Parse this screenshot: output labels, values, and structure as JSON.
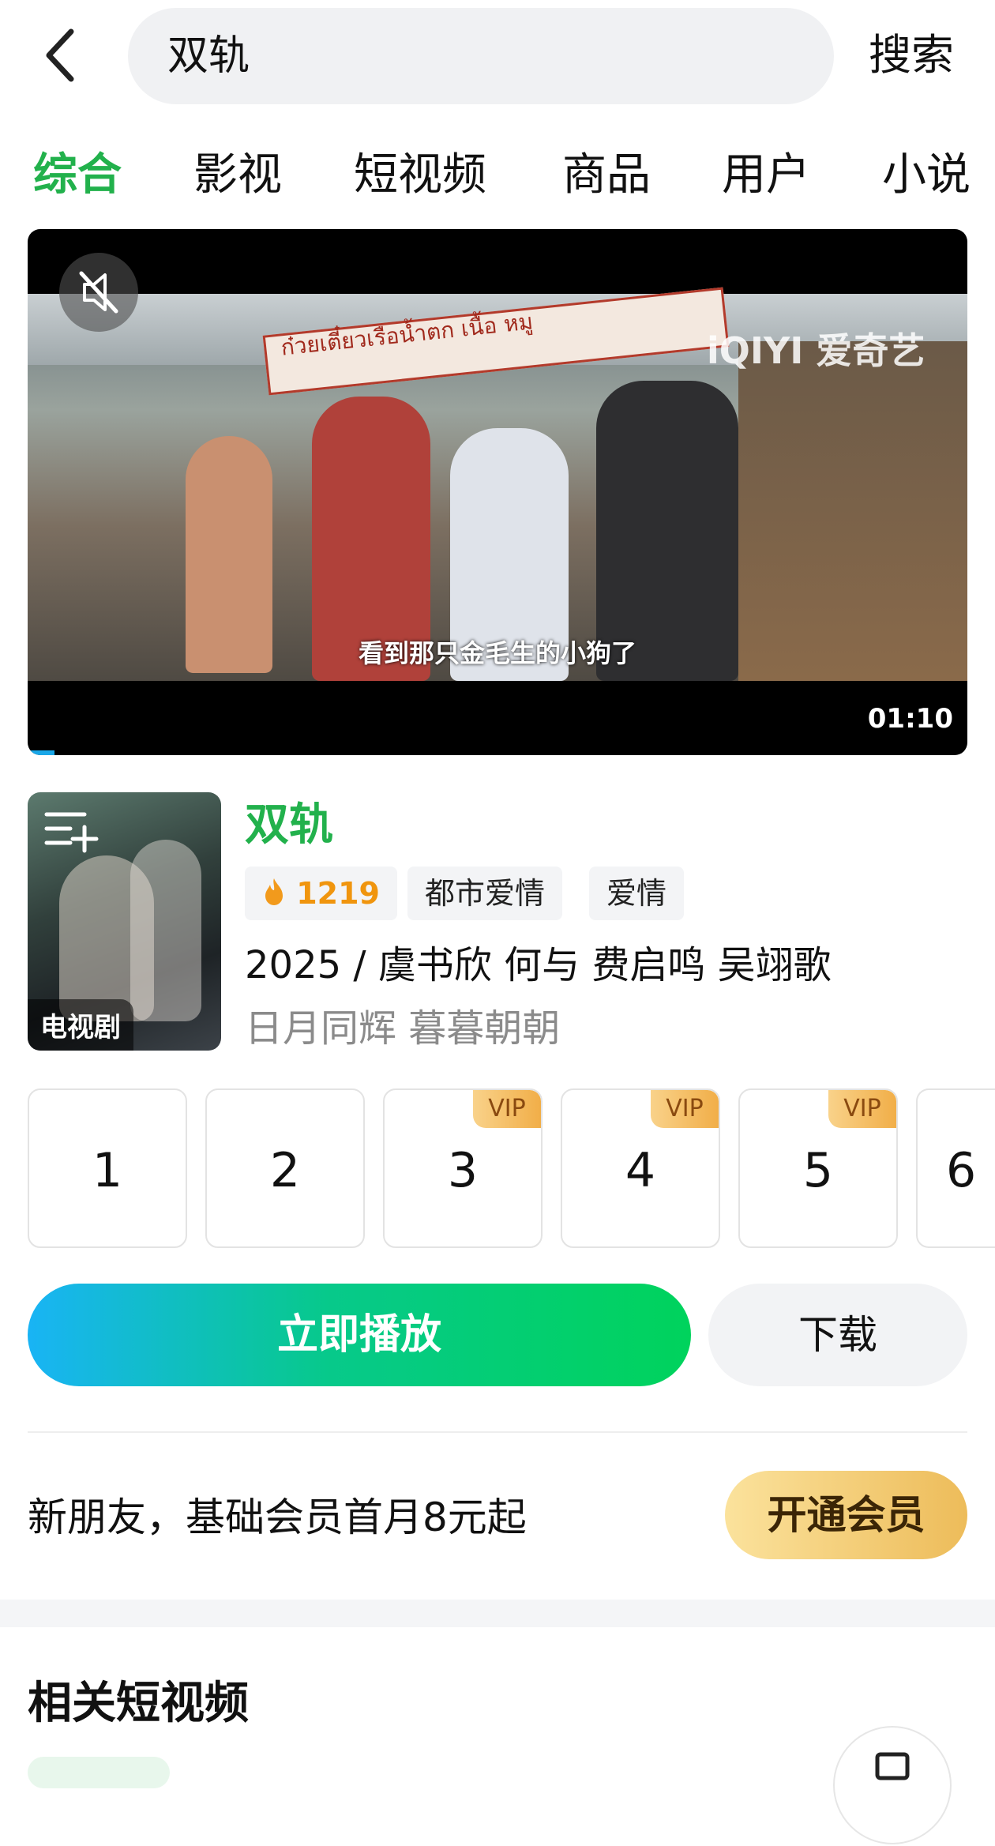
{
  "header": {
    "search_query": "双轨",
    "search_button": "搜索"
  },
  "tabs": [
    "综合",
    "影视",
    "短视频",
    "商品",
    "用户",
    "小说"
  ],
  "active_tab": 0,
  "video": {
    "sign_text": "ก๋วยเตี๋ยวเรือน้ำตก เนื้อ หมู",
    "watermark": "iQIYI 爱奇艺",
    "subtitle": "看到那只金毛生的小狗了",
    "duration": "01:10"
  },
  "show": {
    "badge": "电视剧",
    "title": "双轨",
    "heat": "1219",
    "genres": [
      "都市爱情",
      "爱情"
    ],
    "meta": "2025 / 虞书欣  何与  费启鸣  吴翊歌",
    "related": "日月同辉 暮暮朝朝"
  },
  "episodes": [
    {
      "num": "1",
      "vip": ""
    },
    {
      "num": "2",
      "vip": ""
    },
    {
      "num": "3",
      "vip": "VIP"
    },
    {
      "num": "4",
      "vip": "VIP"
    },
    {
      "num": "5",
      "vip": "VIP"
    },
    {
      "num": "6",
      "vip": ""
    }
  ],
  "actions": {
    "play": "立即播放",
    "download": "下载"
  },
  "promo": {
    "text": "新朋友，基础会员首月8元起",
    "button": "开通会员"
  },
  "section": {
    "title": "相关短视频"
  },
  "colors": {
    "accent_green": "#22b14c",
    "heat_orange": "#f0950e",
    "vip_gold": "#f1ae48"
  }
}
